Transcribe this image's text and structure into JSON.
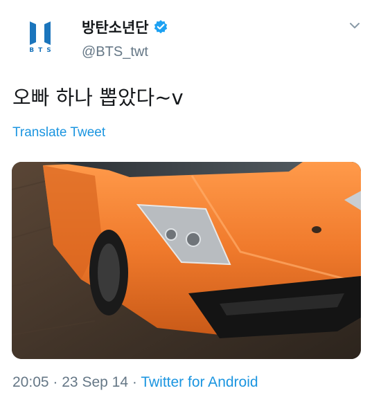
{
  "author": {
    "display_name": "방탄소년단",
    "handle": "@BTS_twt",
    "avatar_text": "BTS",
    "verified": true
  },
  "tweet": {
    "text": "오빠 하나 뽑았다~v",
    "translate_label": "Translate Tweet",
    "time": "20:05",
    "date": "23 Sep 14",
    "source": "Twitter for Android",
    "separator": "·"
  },
  "icons": {
    "avatar_logo": "bts-logo-icon",
    "verified": "verified-badge-icon",
    "menu": "chevron-down-icon"
  },
  "colors": {
    "link": "#1b95e0",
    "secondary_text": "#657786",
    "brand_blue": "#1b75bc",
    "car_orange": "#f07a2c"
  }
}
